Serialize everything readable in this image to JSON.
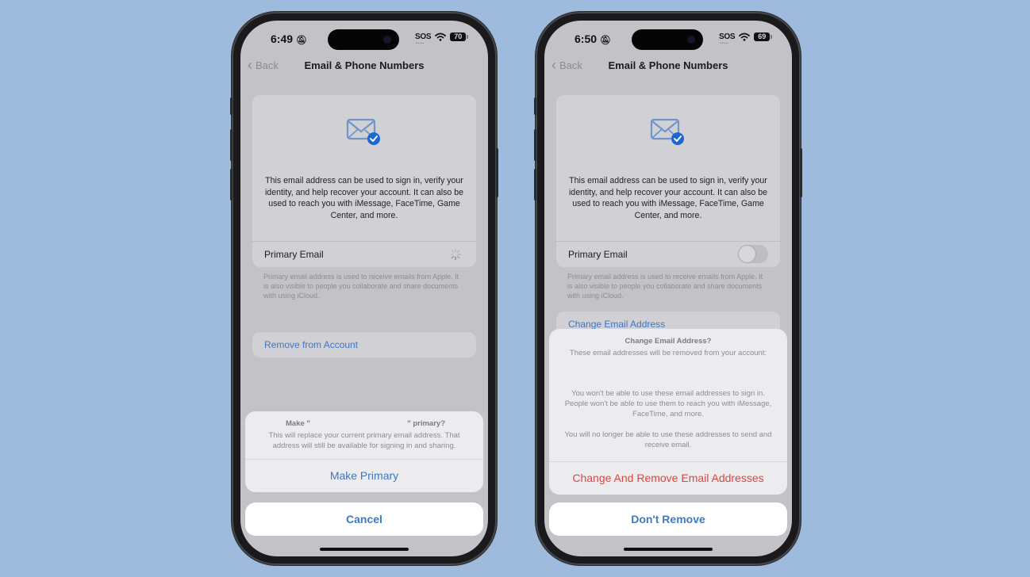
{
  "colors": {
    "background": "#9ebadd",
    "link_blue": "#3d77c4",
    "destructive_red": "#e0443e",
    "check_badge_blue": "#1b66d2"
  },
  "phones": [
    {
      "status_bar": {
        "time": "6:49",
        "bell_icon": "bell-slash-icon",
        "sos": "SOS",
        "wifi_icon": "wifi-icon",
        "battery": "70"
      },
      "nav": {
        "back_label": "Back",
        "title": "Email & Phone Numbers"
      },
      "info_card": {
        "icon": "envelope-check-icon",
        "text": "This email address can be used to sign in, verify your identity, and help recover your account. It can also be used to reach you with iMessage, FaceTime, Game Center, and more.",
        "primary_label": "Primary Email",
        "primary_state": "loading-spinner"
      },
      "footnote": "Primary email address is used to receive emails from Apple. It is also visible to people you collaborate and share documents with using iCloud.",
      "link_row": "Remove from Account",
      "sheet": {
        "title_prefix": "Make \"",
        "title_suffix": "\" primary?",
        "message": "This will replace your current primary email address. That address will still be available for signing in and sharing.",
        "action": "Make Primary",
        "cancel": "Cancel"
      }
    },
    {
      "status_bar": {
        "time": "6:50",
        "bell_icon": "bell-slash-icon",
        "sos": "SOS",
        "wifi_icon": "wifi-icon",
        "battery": "69"
      },
      "nav": {
        "back_label": "Back",
        "title": "Email & Phone Numbers"
      },
      "info_card": {
        "icon": "envelope-check-icon",
        "text": "This email address can be used to sign in, verify your identity, and help recover your account. It can also be used to reach you with iMessage, FaceTime, Game Center, and more.",
        "primary_label": "Primary Email",
        "primary_state": "toggle-off"
      },
      "footnote": "Primary email address is used to receive emails from Apple. It is also visible to people you collaborate and share documents with using iCloud.",
      "link_row": "Change Email Address",
      "sheet": {
        "title": "Change Email Address?",
        "subtitle": "These email addresses will be removed from your account:",
        "message1": "You won't be able to use these email addresses to sign in. People won't be able to use them to reach you with iMessage, FaceTime, and more.",
        "message2": "You will no longer be able to use these addresses to send and receive email.",
        "action": "Change And Remove Email Addresses",
        "cancel": "Don't Remove"
      }
    }
  ]
}
